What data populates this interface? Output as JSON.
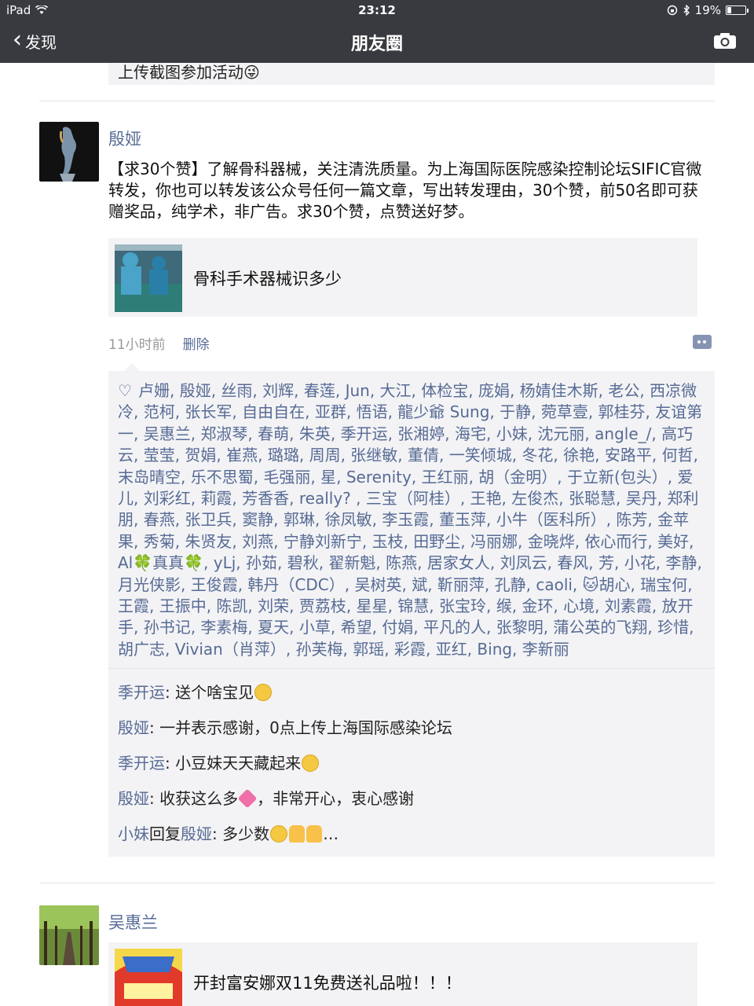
{
  "status": {
    "device": "iPad",
    "time": "23:12",
    "battery": "19%",
    "battery_level": 0.19
  },
  "nav": {
    "back_label": "发现",
    "title": "朋友圈"
  },
  "previous_post": {
    "tail_text": "上传截图参加活动😜"
  },
  "post1": {
    "author": "殷娅",
    "text": "【求30个赞】了解骨科器械，关注清洗质量。为上海国际医院感染控制论坛SIFIC官微转发，你也可以转发该公众号任何一篇文章，写出转发理由，30个赞，前50名即可获赠奖品，纯学术，非广告。求30个赞，点赞送好梦。",
    "link_title": "骨科手术器械识多少",
    "time": "11小时前",
    "delete_label": "删除",
    "likes": "卢姗, 殷娅, 丝雨, 刘辉, 春莲, Jun, 大江, 体检宝, 庞娟, 杨婧佳木斯, 老公, 西凉微冷, 范柯, 张长军, 自由自在, 亚群, 悟语, 龍少爺 Sung, 于静, 菀草壹, 郭桂芬, 友谊第一, 吴惠兰, 郑淑琴, 春萌, 朱英, 季开运, 张湘婷, 海宅, 小妹, 沈元丽, angle_/, 高巧云, 莹莹, 贺娟, 崔燕, 璐璐, 周周, 张继敏, 董倩, 一笑倾城, 冬花, 徐艳, 安路平, 何哲, 末岛晴空, 乐不思蜀, 毛强丽, 星, Serenity, 王红丽, 胡（金明）, 于立新(包头）, 爱儿, 刘彩红, 莉霞, 芳香香, really? , 三宝（阿桂）, 王艳, 左俊杰, 张聪慧, 吴丹, 郑利朋, 春燕, 张卫兵, 窦静, 郭琳, 徐凤敏, 李玉霞, 董玉萍, 小牛（医科所）, 陈芳, 金苹果, 秀菊, 朱贤友, 刘燕, 宁静刘新宁, 玉枝, 田野尘, 冯丽娜, 金晓烨, 依心而行, 美好, Al🍀真真🍀, yLj, 孙茹, 碧秋, 翟新魁, 陈燕, 居家女人, 刘凤云, 春风, 芳, 小花, 李静, 月光侠影, 王俊霞, 韩丹（CDC）, 吴树英, 斌, 靳丽萍, 孔静, caoli, 🐱胡心, 瑞宝何, 王霞, 王振中, 陈凯, 刘荣, 贾荔枝, 星星, 锦慧, 张宝玲, 缑, 金环, 心境, 刘素霞, 放开手, 孙书记, 李素梅, 夏天, 小草, 希望, 付娟, 平凡的人, 张黎明, 蒲公英的飞翔, 珍惜, 胡广志, Vivian（肖萍）, 孙芙梅, 郭瑶, 彩霞, 亚红, Bing, 李新丽",
    "comments": [
      {
        "name": "季开运",
        "text": ": 送个啥宝见",
        "emoji": "yellow"
      },
      {
        "name": "殷娅",
        "text": ": 一并表示感谢，0点上传上海国际感染论坛",
        "emoji": ""
      },
      {
        "name": "季开运",
        "text": ": 小豆妹天天藏起来",
        "emoji": "yellow"
      },
      {
        "name": "殷娅",
        "text": ": 收获这么多",
        "emoji": "pink",
        "after": "，非常开心，衷心感谢"
      }
    ],
    "reply": {
      "from": "小妹",
      "mid": "回复",
      "to": "殷娅",
      "text": ": 多少数",
      "after": "…"
    }
  },
  "post2": {
    "author": "吴惠兰",
    "link_title": "开封富安娜双11免费送礼品啦！！！"
  }
}
